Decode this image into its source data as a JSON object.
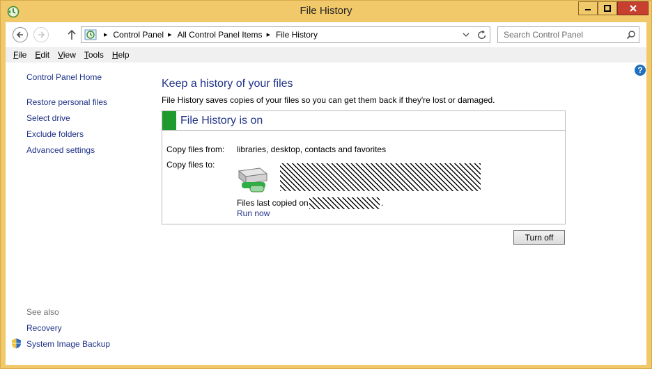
{
  "window": {
    "title": "File History",
    "controls": {
      "minimize": "minimize",
      "maximize": "maximize",
      "close": "close"
    }
  },
  "address": {
    "crumbs": [
      "Control Panel",
      "All Control Panel Items",
      "File History"
    ],
    "search_placeholder": "Search Control Panel"
  },
  "menu": [
    {
      "accel": "F",
      "rest": "ile"
    },
    {
      "accel": "E",
      "rest": "dit"
    },
    {
      "accel": "V",
      "rest": "iew"
    },
    {
      "accel": "T",
      "rest": "ools"
    },
    {
      "accel": "H",
      "rest": "elp"
    }
  ],
  "sidebar": {
    "home": "Control Panel Home",
    "links": [
      "Restore personal files",
      "Select drive",
      "Exclude folders",
      "Advanced settings"
    ],
    "see_also": "See also",
    "see_also_links": [
      "Recovery",
      "System Image Backup"
    ]
  },
  "main": {
    "title": "Keep a history of your files",
    "description": "File History saves copies of your files so you can get them back if they're lost or damaged.",
    "status_title": "File History is on",
    "status_color": "#1f9b2d",
    "copy_from_label": "Copy files from:",
    "copy_from_value": "libraries, desktop, contacts and favorites",
    "copy_to_label": "Copy files to:",
    "last_copied_prefix": "Files last copied on",
    "last_copied_suffix": ".",
    "run_now": "Run now",
    "turn_off": "Turn off"
  },
  "help": "?",
  "colors": {
    "frame": "#f1c86a",
    "link": "#1e3287",
    "close": "#c7402f"
  },
  "icons": [
    "file-history-icon",
    "back-arrow-icon",
    "forward-arrow-icon",
    "up-arrow-icon",
    "dropdown-icon",
    "refresh-icon",
    "search-icon",
    "help-icon",
    "drive-icon",
    "shield-icon"
  ]
}
